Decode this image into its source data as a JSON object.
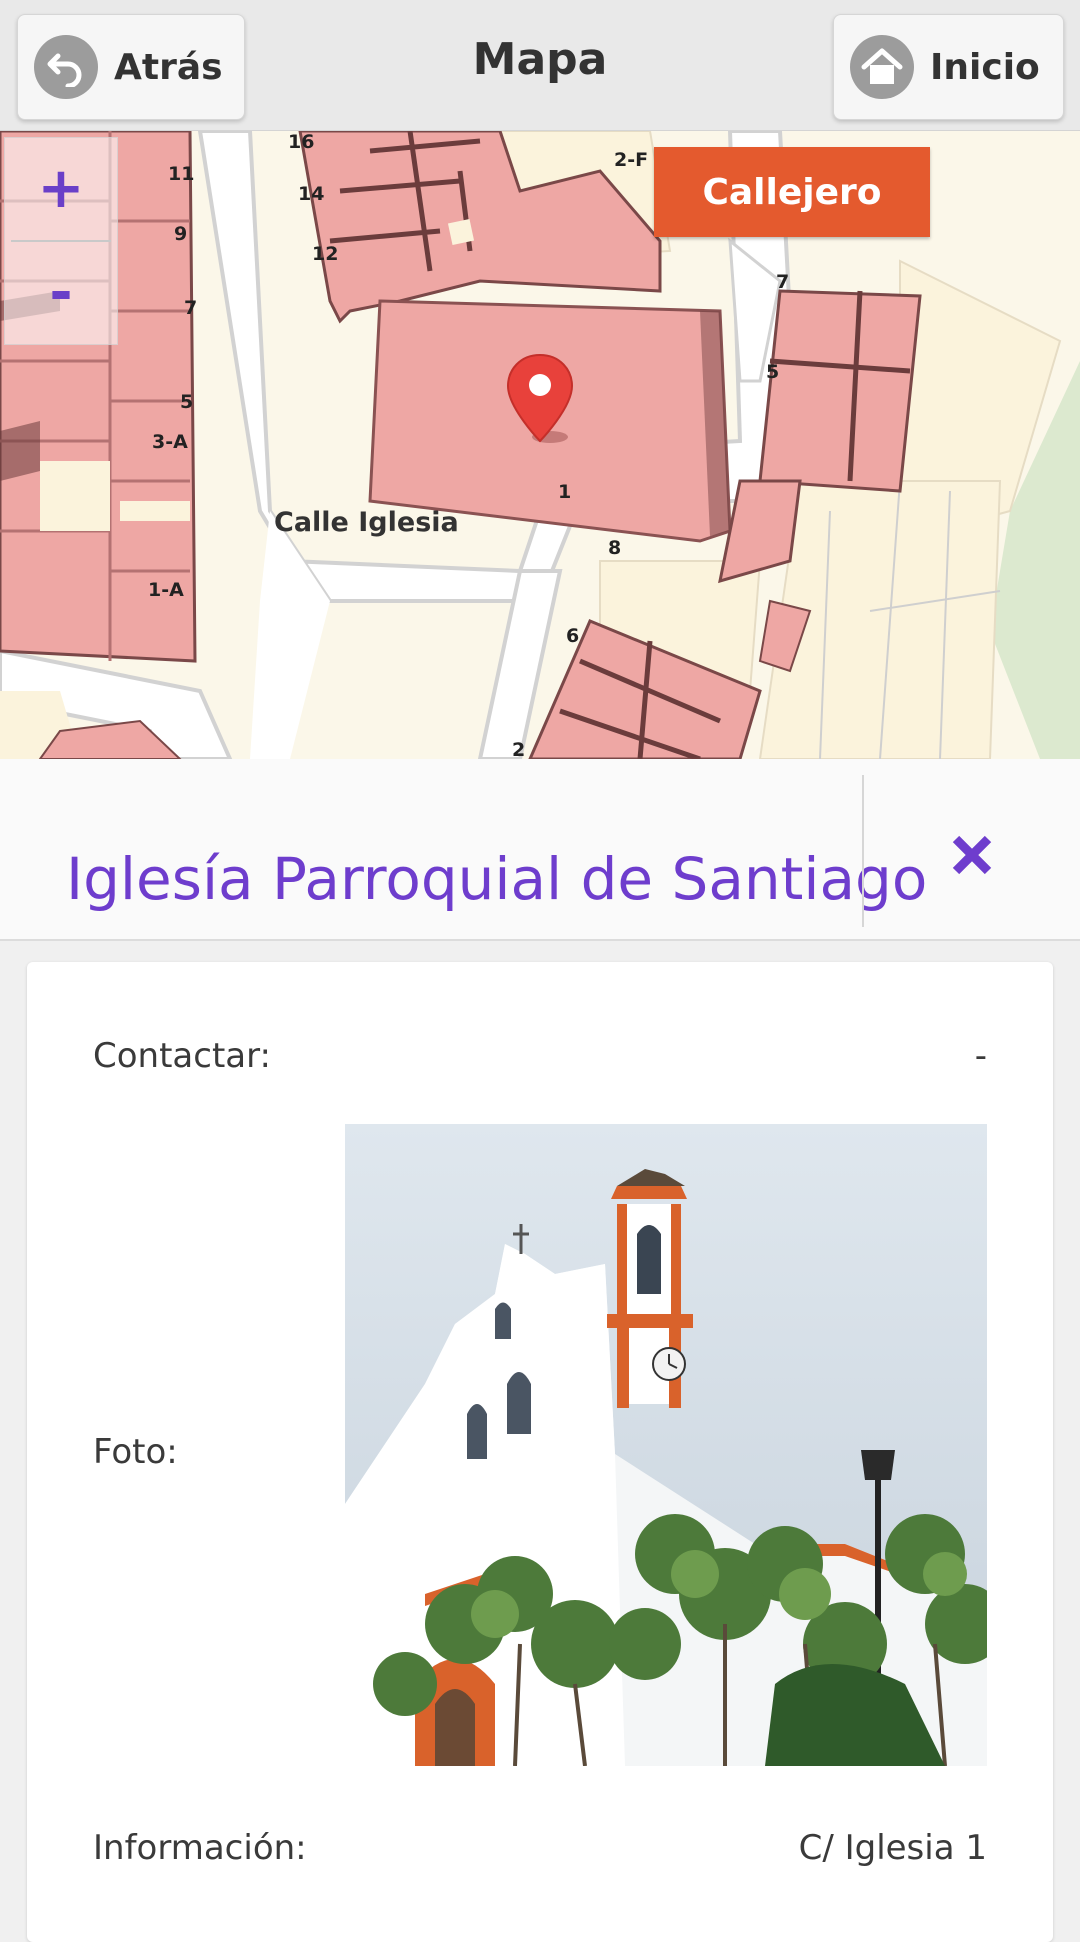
{
  "header": {
    "back_label": "Atrás",
    "title": "Mapa",
    "home_label": "Inicio"
  },
  "map": {
    "zoom_in": "+",
    "zoom_out": "-",
    "streets_button": "Callejero",
    "street_name": "Calle Iglesia",
    "house_numbers": [
      "16",
      "11",
      "14",
      "9",
      "12",
      "7",
      "5",
      "3-A",
      "1-A",
      "2-F",
      "7",
      "5",
      "1",
      "8",
      "6",
      "2"
    ]
  },
  "place": {
    "title": "Iglesía Parroquial de Santiago"
  },
  "details": {
    "contact_label": "Contactar:",
    "contact_value": "-",
    "photo_label": "Foto:",
    "info_label": "Información:",
    "info_value": "C/ Iglesia 1"
  },
  "colors": {
    "accent_purple": "#6e3dcd",
    "streets_button_bg": "#e45a2e",
    "building_fill": "#eea7a4",
    "pin_red": "#e8413b"
  }
}
